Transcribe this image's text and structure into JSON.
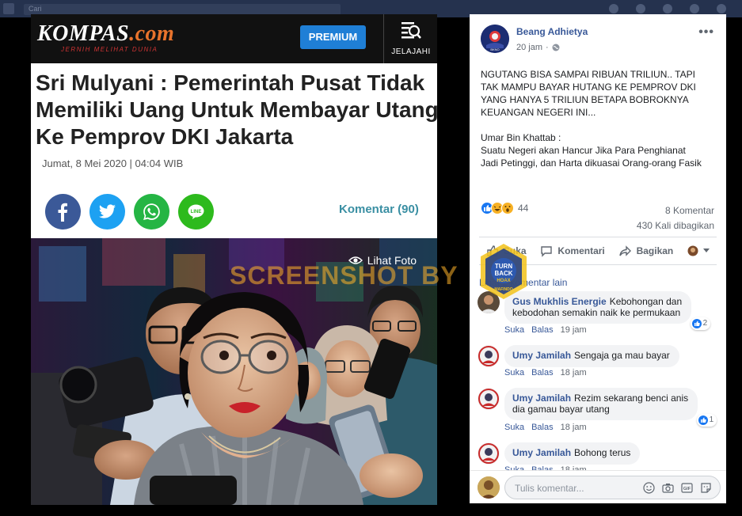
{
  "topbar": {
    "search_text": "Cari"
  },
  "article": {
    "site_logo": "KOMPAS",
    "site_logo_suffix": ".com",
    "tagline": "JERNIH MELIHAT DUNIA",
    "premium_label": "PREMIUM",
    "jelajahi_label": "JELAJAHI",
    "headline_lines": [
      "Sri Mulyani : Pemerintah Pusat Tidak",
      "Memiliki Uang Untuk Membayar Utang",
      "Ke Pemprov DKI Jakarta"
    ],
    "date": "Jumat, 8 Mei 2020 | 04:04 WIB",
    "share_icons": [
      "facebook-icon",
      "twitter-icon",
      "whatsapp-icon",
      "line-icon"
    ],
    "komentar_label": "Komentar (90)",
    "lihat_foto": "Lihat Foto",
    "watermark": "SCREENSHOT BY"
  },
  "post": {
    "author": "Beang Adhietya",
    "time": "20 jam",
    "text_lines": [
      "NGUTANG BISA SAMPAI RIBUAN TRILIUN.. TAPI",
      "TAK MAMPU BAYAR HUTANG KE PEMPROV DKI",
      "YANG HANYA 5 TRILIUN BETAPA BOBROKNYA",
      "KEUANGAN NEGERI INI...",
      "",
      "Umar Bin Khattab :",
      "Suatu Negeri akan Hancur Jika Para Penghianat",
      "Jadi Petinggi, dan Harta dikuasai Orang-orang Fasik"
    ],
    "reaction_count": "44",
    "comments_count": "8 Komentar",
    "shares_count": "430 Kali dibagikan",
    "actions": {
      "like": "Suka",
      "comment": "Komentari",
      "share": "Bagikan"
    },
    "see_more": "Lihat 2 komentar lain",
    "comments": [
      {
        "name": "Gus Mukhlis Energie",
        "text_lines": [
          "Kebohongan dan",
          "kebodohan semakin naik ke permukaan"
        ],
        "like": "Suka",
        "reply": "Balas",
        "time": "19 jam",
        "reactions": "2"
      },
      {
        "name": "Umy Jamilah",
        "text_lines": [
          "Sengaja ga mau bayar"
        ],
        "like": "Suka",
        "reply": "Balas",
        "time": "18 jam"
      },
      {
        "name": "Umy Jamilah",
        "text_lines": [
          "Rezim sekarang benci anis",
          "dia gamau bayar utang"
        ],
        "like": "Suka",
        "reply": "Balas",
        "time": "18 jam",
        "reactions": "1"
      },
      {
        "name": "Umy Jamilah",
        "text_lines": [
          "Bohong terus"
        ],
        "like": "Suka",
        "reply": "Balas",
        "time": "18 jam"
      }
    ],
    "comment_placeholder": "Tulis komentar..."
  },
  "badge": {
    "line1": "TURN",
    "line2": "BACK",
    "line3": "HOAX",
    "line4": "MAFINDO"
  },
  "colors": {
    "fb_blue": "#385898",
    "kompas_orange": "#e8732c",
    "premium_blue": "#1f7fd6",
    "komentar_teal": "#3a8fa3"
  }
}
